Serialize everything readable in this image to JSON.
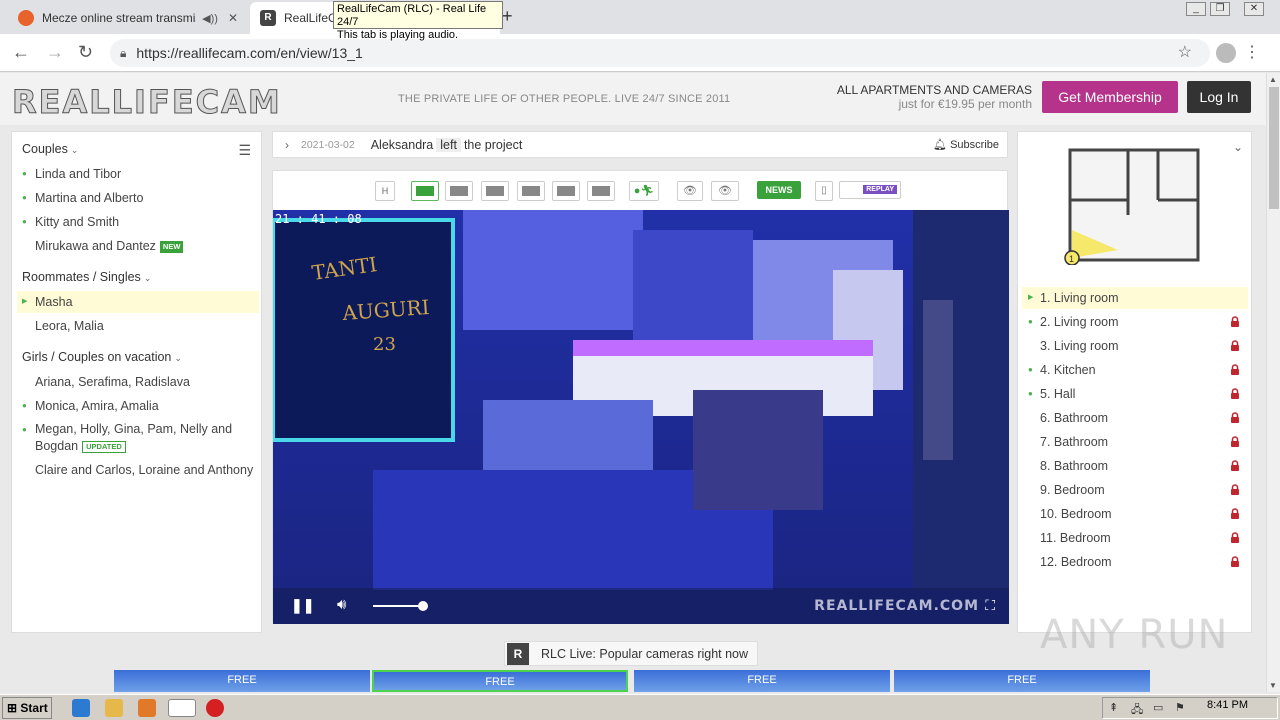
{
  "browser": {
    "tabs": [
      {
        "title": "Mecze online stream transmisje"
      },
      {
        "title": "RealLifeCam (RLC) - Real Life 24/7"
      }
    ],
    "tooltip_line1": "RealLifeCam (RLC) - Real Life 24/7",
    "tooltip_line2": "This tab is playing audio.",
    "url": "https://reallifecam.com/en/view/13_1"
  },
  "header": {
    "logo": "REALLIFECAM",
    "tagline": "THE PRIVATE LIFE OF OTHER PEOPLE. LIVE 24/7 SINCE 2011",
    "promo_line1": "ALL APARTMENTS AND CAMERAS",
    "promo_line2": "just for €19.95 per month",
    "membership_label": "Get Membership",
    "login_label": "Log In"
  },
  "sidebar": {
    "groups": [
      {
        "title": "Couples",
        "items": [
          {
            "label": "Linda and Tibor"
          },
          {
            "label": "Martina and Alberto"
          },
          {
            "label": "Kitty and Smith"
          },
          {
            "label": "Mirukawa and Dantez",
            "badge": "NEW"
          }
        ]
      },
      {
        "title": "Roommates / Singles",
        "items": [
          {
            "label": "Masha"
          },
          {
            "label": "Leora, Malia"
          }
        ]
      },
      {
        "title": "Girls / Couples on vacation",
        "items": [
          {
            "label": "Ariana, Serafima, Radislava"
          },
          {
            "label": "Monica, Amira, Amalia"
          },
          {
            "label": "Megan, Holly, Gina, Pam, Nelly and Bogdan",
            "badge": "UPDATED"
          },
          {
            "label": "Claire and Carlos, Loraine and Anthony"
          }
        ]
      }
    ]
  },
  "news": {
    "date": "2021-03-02",
    "name": "Aleksandra",
    "action": "left",
    "rest": "the project",
    "subscribe_label": "Subscribe"
  },
  "toolbar": {
    "h_label": "H",
    "news_label": "NEWS",
    "replay_label": "REPLAY"
  },
  "video": {
    "timestamp": "21 : 41 : 08",
    "watermark": "REALLIFECAM.COM",
    "volume": 0.85
  },
  "rooms": [
    {
      "label": "1. Living room"
    },
    {
      "label": "2. Living room"
    },
    {
      "label": "3. Living room"
    },
    {
      "label": "4. Kitchen"
    },
    {
      "label": "5. Hall"
    },
    {
      "label": "6. Bathroom"
    },
    {
      "label": "7. Bathroom"
    },
    {
      "label": "8. Bathroom"
    },
    {
      "label": "9. Bedroom"
    },
    {
      "label": "10. Bedroom"
    },
    {
      "label": "11. Bedroom"
    },
    {
      "label": "12. Bedroom"
    }
  ],
  "floorplan": {
    "camera_label": "1"
  },
  "live": {
    "label": "RLC Live: Popular cameras right now",
    "thumbs": [
      "FREE",
      "FREE",
      "FREE",
      "FREE"
    ]
  },
  "taskbar": {
    "start_label": "Start",
    "clock": "8:41 PM"
  },
  "watermark": "ANY RUN",
  "colors": {
    "accent_green": "#3aa23a",
    "membership": "#b5338a",
    "lock_red": "#c0262d"
  }
}
